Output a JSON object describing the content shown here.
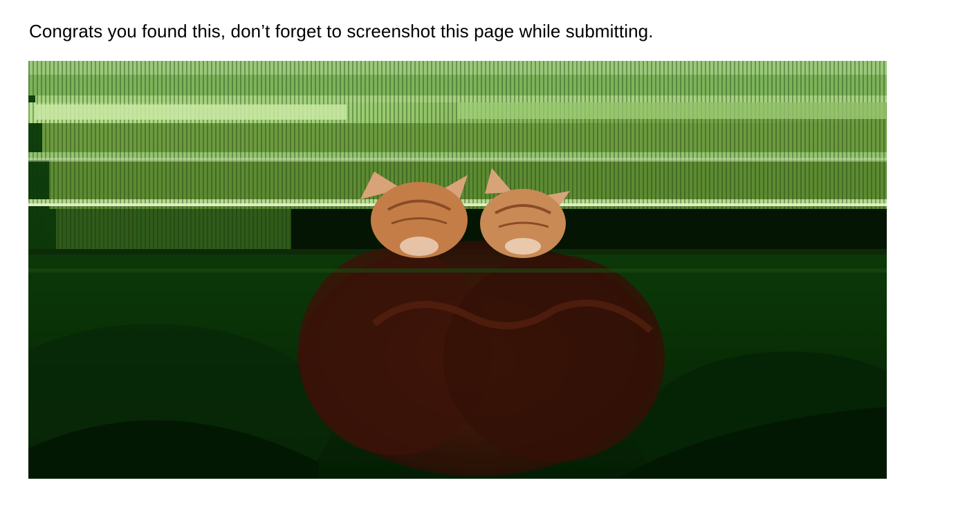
{
  "page": {
    "message": "Congrats you found this, don’t forget to screenshot this page while submitting."
  },
  "image": {
    "subject": "glitched-photo-two-cats",
    "dominant_colors": {
      "upper_band": "#8fc46a",
      "mid_band": "#4f7a2a",
      "lower_field": "#0b3a08",
      "shadow": "#031803",
      "cat_fur": "#c9814a"
    }
  }
}
